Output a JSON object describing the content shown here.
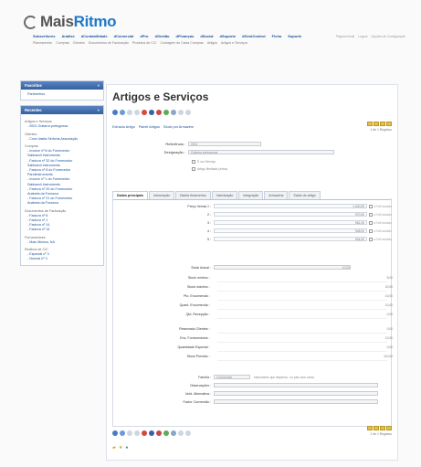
{
  "brand": {
    "prefix": "Mais",
    "suffix": "Ritmo"
  },
  "main_nav": [
    "Subscritores",
    "Análise",
    "dContabilidade",
    "dComercial",
    "dPro",
    "dGestão",
    "dFinanças",
    "dSocial",
    "dSuporte",
    "dGestControl",
    "Ficha",
    "Suporte"
  ],
  "sub_nav": [
    "Planeamento",
    "Compras",
    "Clientes",
    "Documentos de Facturação",
    "Produtos de C/C",
    "Contagem de Caixa Compras",
    "Artigos",
    "Artigos e Serviços"
  ],
  "top_links": [
    "Página Inicial",
    "Logout",
    "Opções de Configuração"
  ],
  "sidebar": {
    "favoritos": {
      "title": "Favoritos",
      "items": [
        "Parâmetros"
      ]
    },
    "recentes": {
      "title": "Recentes",
      "groups": [
        {
          "title": "Artigos e Serviços",
          "items": [
            "- 0001 Guitarra portuguesa"
          ]
        },
        {
          "title": "Clientes",
          "items": [
            "- Cora Vasita Sinfonia Associação"
          ]
        },
        {
          "title": "Compras",
          "items": [
            "- Invoice nº 8 do Fornecedor",
            "Sabbaroli Instruments",
            "- Factura nº 32 do Fornecedor",
            "Sabbaroli Instruments",
            "- Factura nº 8 do Fornecedor",
            "Parolinstruments",
            "- Invoice nº 1 do Fornecedor",
            "Sabbaroli Instruments",
            "- Factura nº 20 do Fornecedor",
            "Anabela da Fonseca",
            "- Factura nº 21 do Fornecedor",
            "Anabela da Fonseca"
          ]
        },
        {
          "title": "Documentos de Facturação",
          "items": [
            "- Factura nº 6",
            "- Factura nº 1",
            "- Factura nº 14",
            "- Factura nº 14"
          ]
        },
        {
          "title": "Fornecedores",
          "items": [
            "- Mais Música, NA"
          ]
        },
        {
          "title": "Recibos de C/C",
          "items": [
            "- Especial nº 3",
            "- Normal nº 3"
          ]
        }
      ]
    }
  },
  "main": {
    "title": "Artigos e Serviços",
    "actions": [
      "Extracto Artigo",
      "Painel Artigos",
      "Stock por Armazém"
    ],
    "nav_count": "1 de 1 Registos",
    "referencia": {
      "label": "Referência :",
      "value": "0001"
    },
    "designacao": {
      "label": "Designação :",
      "value": "Guitarra portuguesa"
    },
    "check1": "É um Serviço",
    "check2": "Artigo Ilimitado (extra)",
    "tabs": [
      "Dados principais",
      "Informação",
      "Dados financeiros",
      "Valorização",
      "Integração",
      "Armazéns",
      "Saldo do artigo"
    ],
    "prices_label": "Preço Venda 1 :",
    "prices": [
      {
        "label": "Preço Venda 1 :",
        "value": "1.000,00",
        "iva": "c/ IVA incluído"
      },
      {
        "label": "2 :",
        "value": "970,00",
        "iva": "c/ IVA incluído"
      },
      {
        "label": "3 :",
        "value": "961,00",
        "iva": "c/ IVA incluído"
      },
      {
        "label": "4 :",
        "value": "948,00",
        "iva": "c/ IVA incluído"
      },
      {
        "label": "5 :",
        "value": "944,00",
        "iva": "c/ IVA incluído"
      }
    ],
    "stock_actual": {
      "label": "Stock Actual :",
      "value": "10,00"
    },
    "stock_rows": [
      {
        "label": "Stock mínimo :",
        "value": "5,00"
      },
      {
        "label": "Stock máximo :",
        "value": "20,00"
      },
      {
        "label": "Pto. Encomenda :",
        "value": "10,00"
      },
      {
        "label": "Quant. Encomenda :",
        "value": "10,00"
      },
      {
        "label": "Qtd. Recepção :",
        "value": "0,00"
      }
    ],
    "stock_rows2": [
      {
        "label": "Reservado Clientes :",
        "value": "0,00"
      },
      {
        "label": "Enc. Fornecedores :",
        "value": "10,00"
      },
      {
        "label": "Quantidade Especial :",
        "value": "0,00"
      },
      {
        "label": "Stock Previsto :",
        "value": "110,00"
      }
    ],
    "familia": {
      "label": "Família :",
      "value": "Cordofones",
      "hint": "Instrumento que dispensa - ou pelo arco corda"
    },
    "bottom_labels": [
      "Observações :",
      "Unid. Alternativa :",
      "Factor Conversão :"
    ]
  },
  "colors": {
    "accent": "#34609f",
    "brand": "#1f78c9",
    "nav_gold": "#e5c04a"
  }
}
